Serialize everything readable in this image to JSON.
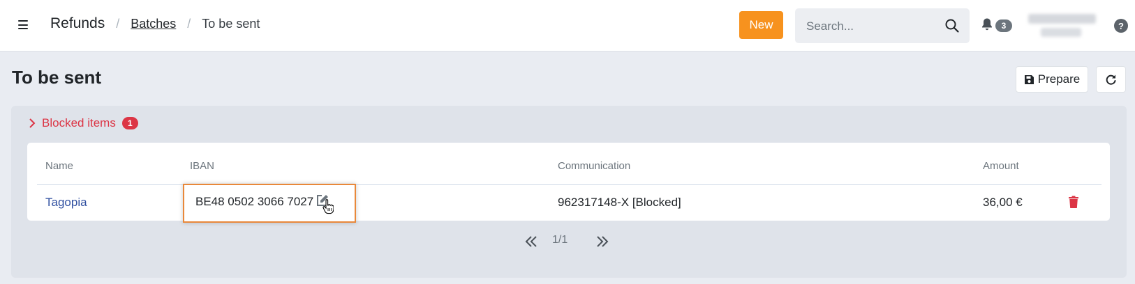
{
  "header": {
    "breadcrumb": {
      "root": "Refunds",
      "sep1": "/",
      "link": "Batches",
      "sep2": "/",
      "current": "To be sent"
    },
    "new_button": "New",
    "search": {
      "placeholder": "Search...",
      "value": ""
    },
    "notifications_count": "3",
    "help_label": "?"
  },
  "page": {
    "title": "To be sent",
    "prepare_button": "Prepare"
  },
  "blocked": {
    "label": "Blocked items",
    "count": "1",
    "table": {
      "columns": {
        "name": "Name",
        "iban": "IBAN",
        "communication": "Communication",
        "amount": "Amount"
      },
      "rows": [
        {
          "name": "Tagopia",
          "iban": "BE48 0502 3066 7027",
          "communication": "962317148-X [Blocked]",
          "amount": "36,00 €"
        }
      ]
    },
    "pagination": {
      "text": "1/1"
    }
  },
  "colors": {
    "accent": "#f7921e",
    "danger": "#dc3545",
    "link": "#2f4fa0",
    "highlight": "#e9883a"
  },
  "icons": [
    "menu-icon",
    "search-icon",
    "bell-icon",
    "help-icon",
    "save-icon",
    "refresh-icon",
    "chevron-right-icon",
    "edit-icon",
    "hand-cursor-icon",
    "trash-icon",
    "double-chevron-left-icon",
    "double-chevron-right-icon"
  ]
}
